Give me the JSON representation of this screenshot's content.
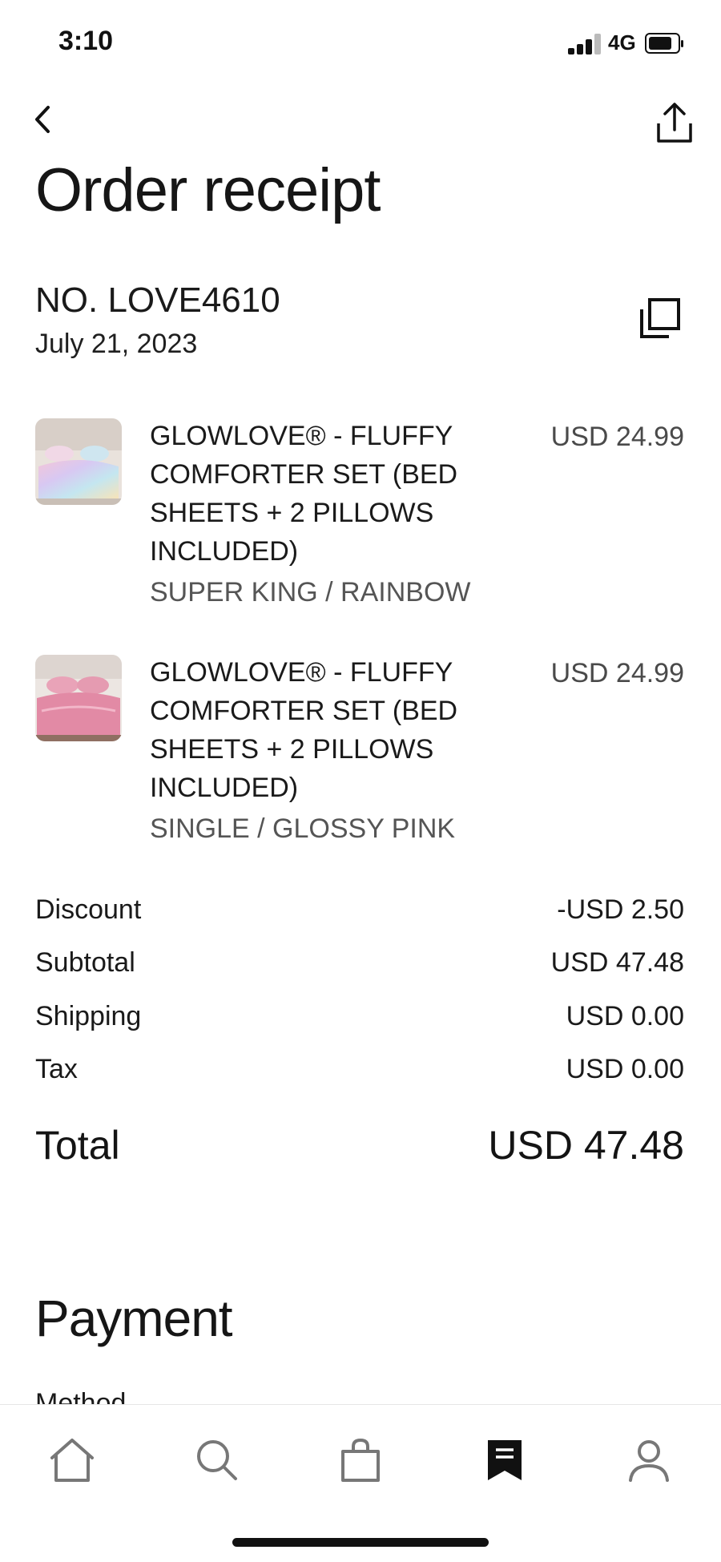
{
  "status_bar": {
    "time": "3:10",
    "network": "4G",
    "icons": [
      "signal-icon",
      "battery-icon"
    ]
  },
  "header": {
    "back_icon": "chevron-left-icon",
    "share_icon": "share-icon",
    "title": "Order receipt"
  },
  "order": {
    "number": "NO. LOVE4610",
    "date": "July 21, 2023",
    "copy_icon": "copy-icon"
  },
  "items": [
    {
      "title": "GLOWLOVE® - FLUFFY COMFORTER SET (BED SHEETS + 2 PILLOWS INCLUDED)",
      "variant": "SUPER KING / RAINBOW",
      "price": "USD 24.99"
    },
    {
      "title": "GLOWLOVE® - FLUFFY COMFORTER SET (BED SHEETS + 2 PILLOWS INCLUDED)",
      "variant": "SINGLE / GLOSSY PINK",
      "price": "USD 24.99"
    }
  ],
  "summary": {
    "discount_label": "Discount",
    "discount_value": "-USD 2.50",
    "subtotal_label": "Subtotal",
    "subtotal_value": "USD 47.48",
    "shipping_label": "Shipping",
    "shipping_value": "USD 0.00",
    "tax_label": "Tax",
    "tax_value": "USD 0.00",
    "total_label": "Total",
    "total_value": "USD 47.48"
  },
  "payment": {
    "title": "Payment",
    "method_label": "Method"
  },
  "tab_bar": {
    "tabs": [
      {
        "icon": "home-icon",
        "active": false
      },
      {
        "icon": "search-icon",
        "active": false
      },
      {
        "icon": "shopping-bag-icon",
        "active": false
      },
      {
        "icon": "receipt-icon",
        "active": true
      },
      {
        "icon": "profile-icon",
        "active": false
      }
    ]
  },
  "colors": {
    "text": "#1a1a1a",
    "muted": "#555555",
    "price": "#4a4a4a",
    "background": "#ffffff"
  }
}
